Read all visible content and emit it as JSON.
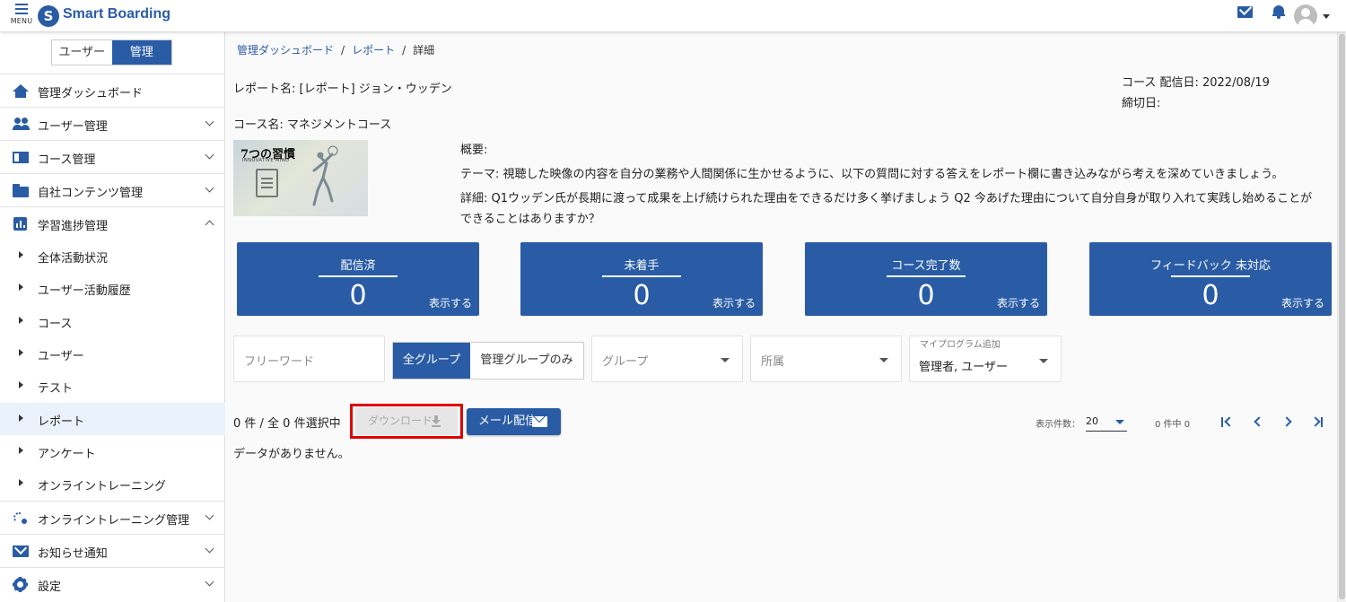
{
  "header": {
    "menu_label": "MENU",
    "logo_mark": "S",
    "app_name": "Smart Boarding"
  },
  "sidebar": {
    "toggle": {
      "user": "ユーザー",
      "admin": "管理"
    },
    "items": [
      {
        "label": "管理ダッシュボード",
        "icon": "home-icon"
      },
      {
        "label": "ユーザー管理",
        "icon": "users-icon"
      },
      {
        "label": "コース管理",
        "icon": "book-icon"
      },
      {
        "label": "自社コンテンツ管理",
        "icon": "folder-icon"
      },
      {
        "label": "学習進捗管理",
        "icon": "bar-chart-icon"
      }
    ],
    "sub_items": [
      {
        "label": "全体活動状況"
      },
      {
        "label": "ユーザー活動履歴"
      },
      {
        "label": "コース"
      },
      {
        "label": "ユーザー"
      },
      {
        "label": "テスト"
      },
      {
        "label": "レポート"
      },
      {
        "label": "アンケート"
      },
      {
        "label": "オンライントレーニング"
      }
    ],
    "bottom_items": [
      {
        "label": "オンライントレーニング管理",
        "icon": "training-icon"
      },
      {
        "label": "お知らせ通知",
        "icon": "mail-icon"
      },
      {
        "label": "設定",
        "icon": "gear-icon"
      }
    ]
  },
  "breadcrumb": {
    "items": [
      "管理ダッシュボード",
      "レポート"
    ],
    "current": "詳細"
  },
  "report": {
    "title": "レポート名: [レポート] ジョン・ウッデン",
    "course": "コース名: マネジメントコース",
    "delivery_date": "コース 配信日: 2022/08/19",
    "deadline": "締切日:",
    "thumb_title": "7つの習慣",
    "thumb_sub": "INNOVATIVE MIND",
    "overview_label": "概要:",
    "theme": "テーマ: 視聴した映像の内容を自分の業務や人間関係に生かせるように、以下の質問に対する答えをレポート欄に書き込みながら考えを深めていきましょう。",
    "detail": "詳細: Q1ウッデン氏が長期に渡って成果を上げ続けられた理由をできるだけ多く挙げましょう Q2 今あげた理由について自分自身が取り入れて実践し始めることができることはありますか？"
  },
  "stats": [
    {
      "label": "配信済",
      "value": "0",
      "action": "表示する"
    },
    {
      "label": "未着手",
      "value": "0",
      "action": "表示する"
    },
    {
      "label": "コース完了数",
      "value": "0",
      "action": "表示する"
    },
    {
      "label": "フィードバック 未対応",
      "value": "0",
      "action": "表示する"
    }
  ],
  "filters": {
    "freeword_placeholder": "フリーワード",
    "seg_all": "全グループ",
    "seg_admin": "管理グループのみ",
    "group_placeholder": "グループ",
    "affiliation_placeholder": "所属",
    "myprogram_label": "マイプログラム追加",
    "myprogram_value": "管理者, ユーザー"
  },
  "list": {
    "count_text": "0 件 / 全 0 件選択中",
    "download_label": "ダウンロード",
    "mail_label": "メール配信",
    "per_page_label": "表示件数：",
    "per_page_value": "20",
    "range_text": "0 件中 0",
    "empty_text": "データがありません。"
  },
  "colors": {
    "primary": "#2a5ca6",
    "highlight": "#e00000"
  }
}
